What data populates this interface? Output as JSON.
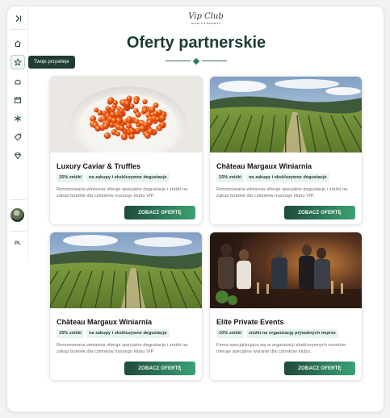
{
  "logo": {
    "name": "Vip Club",
    "tagline": "HOTELS & RESORTS"
  },
  "sidebar": {
    "items": [
      {
        "icon": "collapse-icon"
      },
      {
        "icon": "home-icon"
      },
      {
        "icon": "star-icon",
        "active": true
      },
      {
        "icon": "hotel-icon"
      },
      {
        "icon": "calendar-icon"
      },
      {
        "icon": "spa-icon"
      },
      {
        "icon": "tag-icon"
      },
      {
        "icon": "diamond-icon"
      }
    ],
    "tooltip": "Twoje przywileje",
    "language": "PL"
  },
  "page": {
    "title": "Oferty partnerskie"
  },
  "colors": {
    "primary": "#1e3c31",
    "accent": "#3aa274",
    "badge_bg": "#e9f4ee"
  },
  "offers": [
    {
      "title": "Luxury Caviar & Truffles",
      "discount": "15% zniżki",
      "scope": "na zakupy i ekskluzywne degustacje",
      "description": "Renomowana winiarnia oferuje specjalne degustacje i zniżki na zakup butelek dla członków naszego klubu VIP.",
      "button": "ZOBACZ OFERTĘ",
      "image": "caviar"
    },
    {
      "title": "Château Margaux Winiarnia",
      "discount": "15% zniżki",
      "scope": "na zakupy i ekskluzywne degustacje",
      "description": "Renomowana winiarnia oferuje specjalne degustacje i zniżki na zakup butelek dla członków naszego klubu VIP.",
      "button": "ZOBACZ OFERTĘ",
      "image": "vineyard"
    },
    {
      "title": "Château Margaux Winiarnia",
      "discount": "15% zniżki",
      "scope": "na zakupy i ekskluzywne degustacje",
      "description": "Renomowana winiarnia oferuje specjalne degustacje i zniżki na zakup butelek dla członków naszego klubu VIP.",
      "button": "ZOBACZ OFERTĘ",
      "image": "vineyard"
    },
    {
      "title": "Elite Private Events",
      "discount": "10% zniżki",
      "scope": "zniżki na organizację prywatnych imprez",
      "description": "Firma specjalizująca się w organizacji ekskluzywnych eventów oferuje specjalne warunki dla członków klubu.",
      "button": "ZOBACZ OFERTĘ",
      "image": "party"
    }
  ]
}
